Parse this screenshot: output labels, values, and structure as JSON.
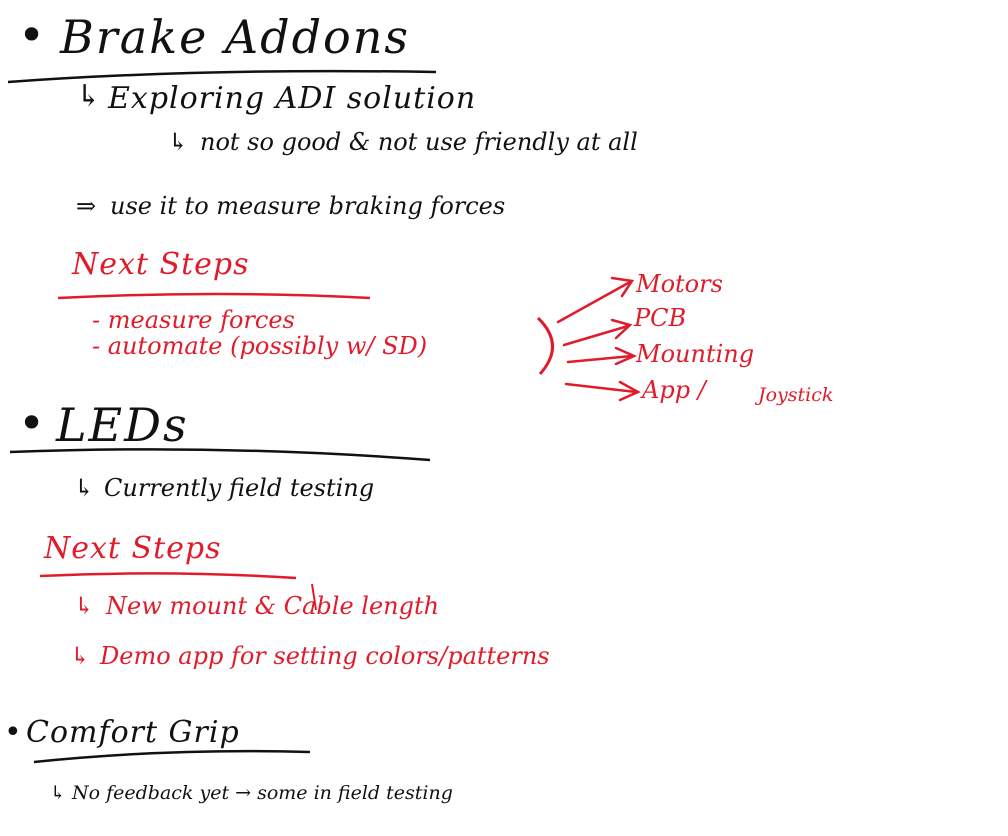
{
  "colors": {
    "ink": "#111111",
    "accent": "#e01c2b"
  },
  "sections": {
    "brake": {
      "bullet": "•",
      "title": "Brake Addons",
      "arrow_mark": "↳",
      "line1": "Exploring ADI solution",
      "line2": "not so good & not use friendly at all",
      "implies_mark": "⇒",
      "line3": "use it to measure braking forces",
      "next_title": "Next Steps",
      "steps": [
        "- measure forces",
        "- automate (possibly w/ SD)"
      ],
      "branches": [
        "Motors",
        "PCB",
        "Mounting",
        "App /",
        "Joystick"
      ]
    },
    "leds": {
      "bullet": "•",
      "title": "LEDs",
      "arrow_mark": "↳",
      "line1": "Currently field testing",
      "next_title": "Next Steps",
      "steps": [
        "New mount & Cable length",
        "Demo app for setting colors/patterns"
      ]
    },
    "grip": {
      "bullet": "•",
      "title": "Comfort Grip",
      "arrow_mark": "↳",
      "line1": "No feedback yet → some in field testing"
    }
  }
}
